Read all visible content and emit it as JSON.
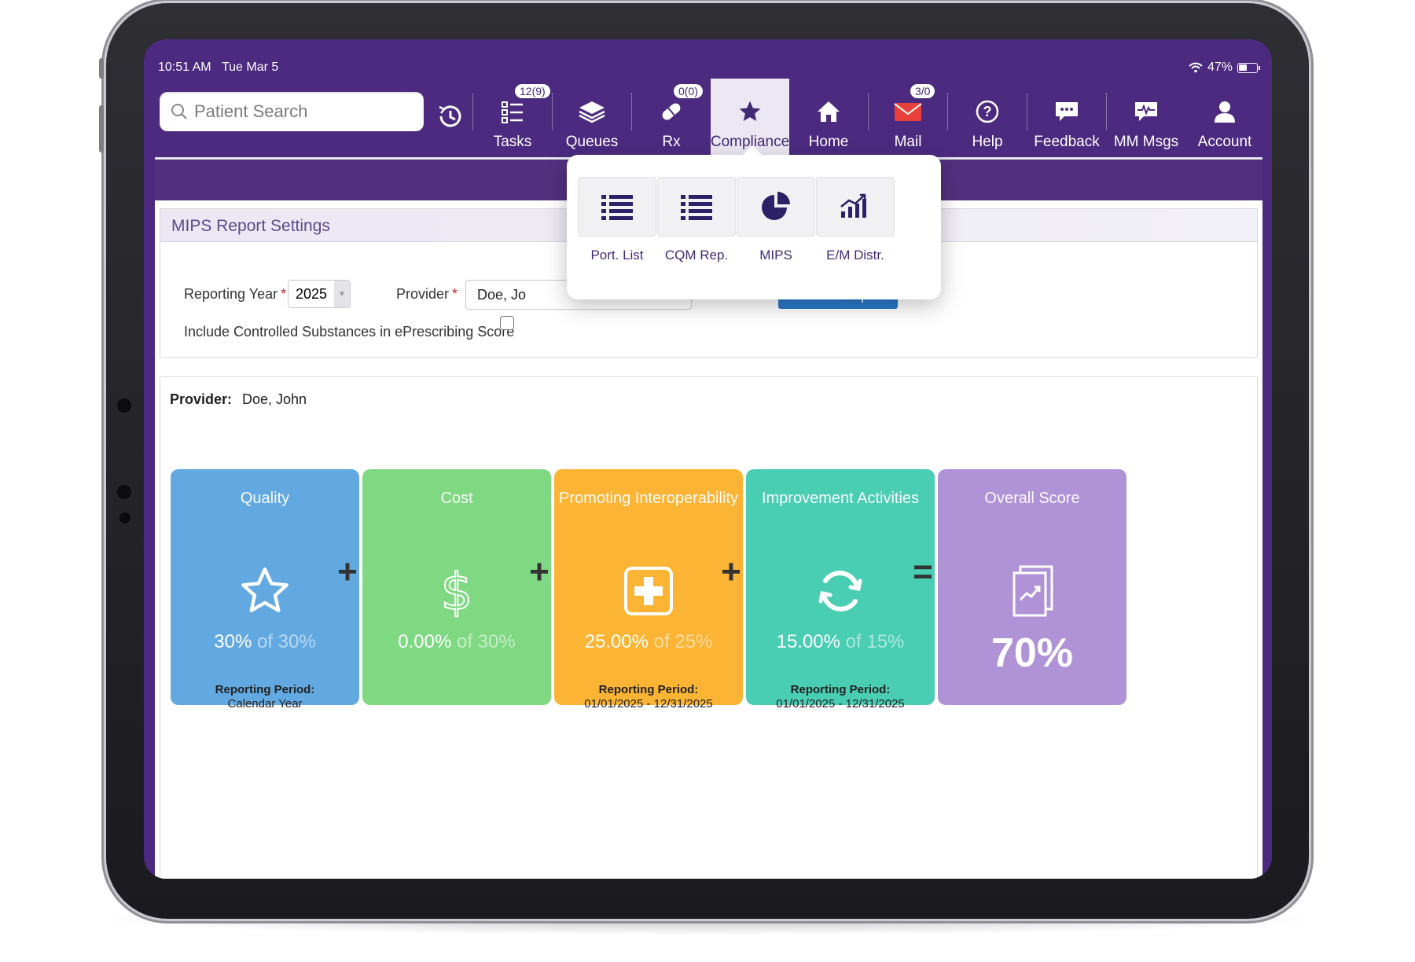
{
  "status": {
    "time": "10:51 AM",
    "date": "Tue Mar 5",
    "battery": "47%"
  },
  "search": {
    "placeholder": "Patient Search"
  },
  "nav": {
    "items": [
      {
        "label": "Tasks",
        "badge": "12(9)"
      },
      {
        "label": "Queues"
      },
      {
        "label": "Rx",
        "badge": "0(0)"
      },
      {
        "label": "Compliance",
        "active": true
      },
      {
        "label": "Home"
      },
      {
        "label": "Mail",
        "badge": "3/0"
      },
      {
        "label": "Help"
      },
      {
        "label": "Feedback"
      },
      {
        "label": "MM Msgs"
      },
      {
        "label": "Account"
      }
    ]
  },
  "compliance_menu": {
    "items": [
      {
        "label": "Port. List",
        "icon": "list-icon"
      },
      {
        "label": "CQM Rep.",
        "icon": "list-icon"
      },
      {
        "label": "MIPS",
        "icon": "pie-chart-icon"
      },
      {
        "label": "E/M Distr.",
        "icon": "bar-chart-icon"
      }
    ]
  },
  "settings": {
    "title": "MIPS Report Settings",
    "reporting_year_label": "Reporting Year",
    "reporting_year_value": "2025",
    "provider_label": "Provider",
    "provider_value": "Doe, Jo",
    "report_button": "Report",
    "controlled_label": "Include Controlled Substances in ePrescribing Score"
  },
  "results": {
    "provider_label": "Provider:",
    "provider_value": "Doe, John",
    "cards": [
      {
        "title": "Quality",
        "value": "30%",
        "of": "of 30%",
        "color": "#62a9e2",
        "icon": "star-icon",
        "period_heading": "Reporting Period:",
        "period": "Calendar Year"
      },
      {
        "title": "Cost",
        "value": "0.00%",
        "of": "of 30%",
        "color": "#7fd882",
        "icon": "dollar-icon"
      },
      {
        "title": "Promoting Interoperability",
        "value": "25.00%",
        "of": "of 25%",
        "color": "#fbb433",
        "icon": "medical-cross-icon",
        "period_heading": "Reporting Period:",
        "period": "01/01/2025 - 12/31/2025"
      },
      {
        "title": "Improvement Activities",
        "value": "15.00%",
        "of": "of 15%",
        "color": "#49cdb3",
        "icon": "refresh-icon",
        "period_heading": "Reporting Period:",
        "period": "01/01/2025 - 12/31/2025"
      },
      {
        "title": "Overall Score",
        "value": "70%",
        "color": "#b093d6",
        "icon": "trend-report-icon"
      }
    ],
    "operators": [
      "+",
      "+",
      "+",
      "="
    ]
  }
}
